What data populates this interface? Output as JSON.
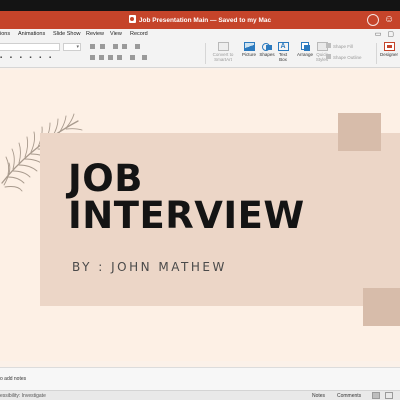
{
  "window": {
    "title": "Job Presentation Main — Saved to my Mac",
    "title_icon": "powerpoint-doc-icon",
    "title_bar_color": "#c5442a"
  },
  "menu": {
    "items": [
      "ions",
      "Animations",
      "Slide Show",
      "Review",
      "View",
      "Record"
    ]
  },
  "ribbon": {
    "font_size_placeholder": "",
    "tools": {
      "convert_label": "Convert to SmartArt",
      "picture_label": "Picture",
      "shapes_label": "Shapes",
      "textbox_label": "Text Box",
      "arrange_label": "Arrange",
      "quick_styles_label": "Quick Styles",
      "shape_fill_label": "Shape Fill",
      "shape_outline_label": "Shape Outline",
      "designer_label": "Designer"
    }
  },
  "slide": {
    "title_line1": "JOB",
    "title_line2": "INTERVIEW",
    "subtitle": "BY : JOHN MATHEW",
    "colors": {
      "background": "#fdf0e5",
      "panel": "#ecd6c7",
      "squares": "#d7bcaa",
      "title": "#141414"
    }
  },
  "notes": {
    "placeholder": "o add notes"
  },
  "status": {
    "accessibility": "essibility: Investigate",
    "notes_label": "Notes",
    "comments_label": "Comments"
  }
}
